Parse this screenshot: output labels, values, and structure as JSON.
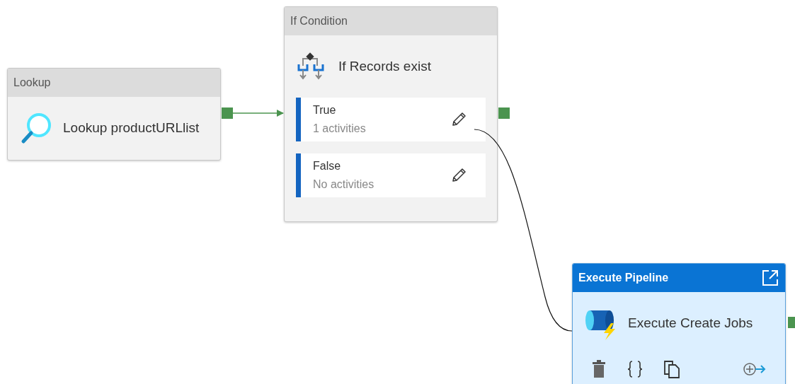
{
  "nodes": [
    {
      "kind": "lookup",
      "header": "Lookup",
      "name": "Lookup productURLlist",
      "selected": false
    },
    {
      "kind": "if_condition",
      "header": "If Condition",
      "name": "If Records exist",
      "selected": false,
      "branches": [
        {
          "label": "True",
          "summary": "1 activities"
        },
        {
          "label": "False",
          "summary": "No activities"
        }
      ]
    },
    {
      "kind": "execute_pipeline",
      "header": "Execute Pipeline",
      "name": "Execute Create Jobs",
      "selected": true
    }
  ]
}
